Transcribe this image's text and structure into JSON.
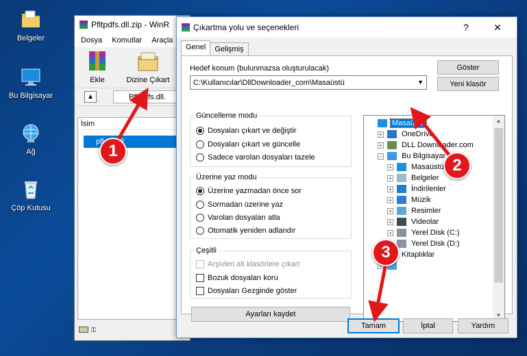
{
  "desktop": {
    "icons": [
      {
        "label": "Belgeler",
        "icon": "folder-documents-icon"
      },
      {
        "label": "Bu Bilgisayar",
        "icon": "computer-icon"
      },
      {
        "label": "Ağ",
        "icon": "network-icon"
      },
      {
        "label": "Çöp Kutusu",
        "icon": "recycle-bin-icon"
      }
    ]
  },
  "winrar": {
    "title": "Pfltpdfs.dll.zip - WinR",
    "menu": [
      "Dosya",
      "Komutlar",
      "Araçla"
    ],
    "toolbar": {
      "add_label": "Ekle",
      "extract_label": "Dizine Çıkart"
    },
    "address": "Pfltpdfs.dll.",
    "column_name": "İsim",
    "file_label": "pfl      dll"
  },
  "dialog": {
    "title": "Çıkartma yolu ve seçenekleri",
    "help": "?",
    "close": "✕",
    "tabs": [
      "Genel",
      "Gelişmiş"
    ],
    "dest_label": "Hedef konum (bulunmazsa oluşturulacak)",
    "dest_value": "C:\\Kullanıcılar\\DllDownloader_com\\Masaüstü",
    "show_button": "Göster",
    "new_folder_button": "Yeni klasör",
    "update_mode": {
      "title": "Güncelleme modu",
      "options": [
        "Dosyaları çıkart ve değiştir",
        "Dosyaları çıkart ve güncelle",
        "Sadece varolan dosyaları tazele"
      ],
      "selected": 0
    },
    "overwrite_mode": {
      "title": "Üzerine yaz modu",
      "options": [
        "Üzerine yazmadan önce sor",
        "Sormadan üzerine yaz",
        "Varolan dosyaları atla",
        "Otomatik yeniden adlandır"
      ],
      "selected": 0
    },
    "misc": {
      "title": "Çeşitli",
      "options": [
        "Arşivleri alt klasörlere çıkart",
        "Bozuk dosyaları koru",
        "Dosyaları Gezginde göster"
      ],
      "disabled": [
        true,
        false,
        false
      ]
    },
    "save_settings_button": "Ayarları kaydet",
    "tree": [
      {
        "label": "Masaüstü",
        "depth": 0,
        "icon": "desktop-icon",
        "expander": "",
        "selected": true
      },
      {
        "label": "OneDrive",
        "depth": 1,
        "icon": "onedrive-icon",
        "expander": "+",
        "selected": false
      },
      {
        "label": "DLL Downloader.com",
        "depth": 1,
        "icon": "user-icon",
        "expander": "+",
        "selected": false
      },
      {
        "label": "Bu Bilgisayar",
        "depth": 1,
        "icon": "computer-icon",
        "expander": "−",
        "selected": false
      },
      {
        "label": "Masaüstü",
        "depth": 2,
        "icon": "desktop-icon",
        "expander": "+",
        "selected": false
      },
      {
        "label": "Belgeler",
        "depth": 2,
        "icon": "documents-icon",
        "expander": "+",
        "selected": false
      },
      {
        "label": "İndirilenler",
        "depth": 2,
        "icon": "downloads-icon",
        "expander": "+",
        "selected": false
      },
      {
        "label": "Müzik",
        "depth": 2,
        "icon": "music-icon",
        "expander": "+",
        "selected": false
      },
      {
        "label": "Resimler",
        "depth": 2,
        "icon": "pictures-icon",
        "expander": "+",
        "selected": false
      },
      {
        "label": "Videolar",
        "depth": 2,
        "icon": "videos-icon",
        "expander": "+",
        "selected": false
      },
      {
        "label": "Yerel Disk (C:)",
        "depth": 2,
        "icon": "drive-icon",
        "expander": "+",
        "selected": false
      },
      {
        "label": "Yerel Disk (D:)",
        "depth": 2,
        "icon": "drive-icon",
        "expander": "+",
        "selected": false
      },
      {
        "label": "Kitaplıklar",
        "depth": 1,
        "icon": "libraries-icon",
        "expander": "+",
        "selected": false
      },
      {
        "label": "",
        "depth": 1,
        "icon": "network-icon",
        "expander": "+",
        "selected": false
      }
    ],
    "ok_button": "Tamam",
    "cancel_button": "İptal",
    "help_button": "Yardım"
  },
  "callouts": [
    "1",
    "2",
    "3"
  ],
  "colors": {
    "callout": "#e2171c",
    "arrow": "#e2171c",
    "selection": "#0078d7"
  }
}
